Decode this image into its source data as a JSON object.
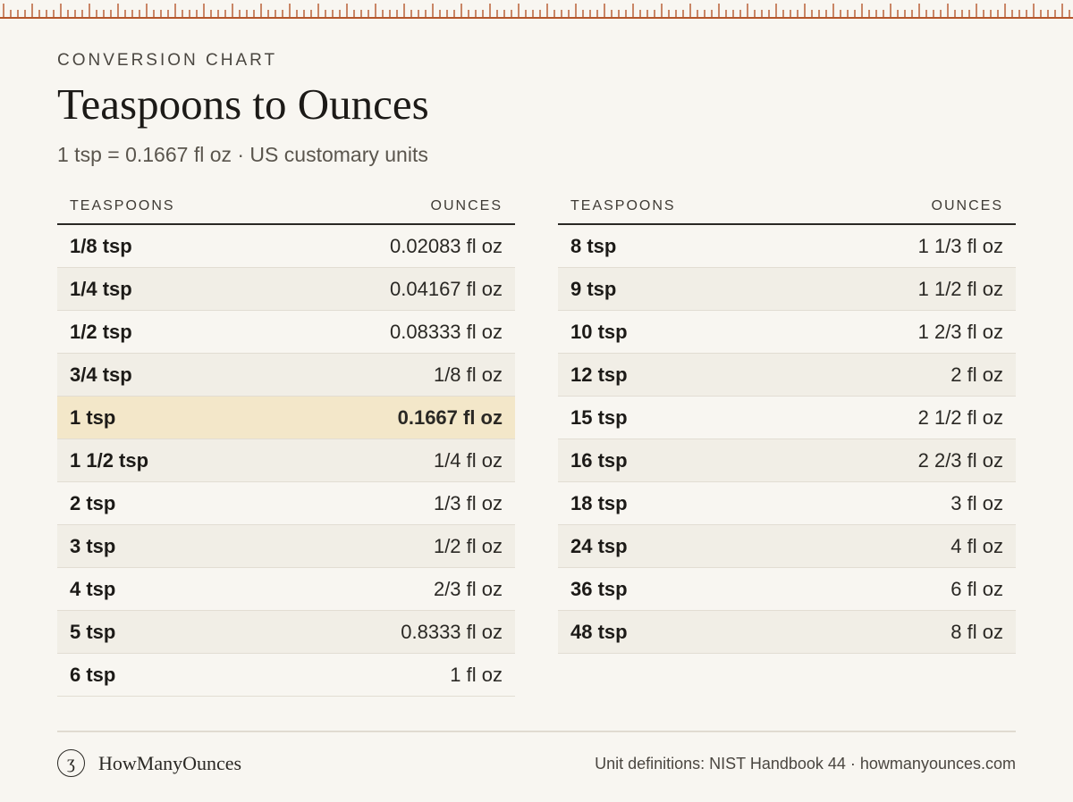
{
  "header": {
    "eyebrow": "CONVERSION CHART",
    "title": "Teaspoons to Ounces",
    "subtitle": "1 tsp = 0.1667 fl oz · US customary units"
  },
  "colors": {
    "ruler": "#b5572c",
    "background": "#f8f6f1",
    "highlight_row": "#f3e7c9",
    "alt_row": "#f1eee6"
  },
  "table_left": {
    "col_tsp": "TEASPOONS",
    "col_oz": "OUNCES",
    "rows": [
      {
        "tsp": "1/8 tsp",
        "oz": "0.02083 fl oz"
      },
      {
        "tsp": "1/4 tsp",
        "oz": "0.04167 fl oz"
      },
      {
        "tsp": "1/2 tsp",
        "oz": "0.08333 fl oz"
      },
      {
        "tsp": "3/4 tsp",
        "oz": "1/8 fl oz"
      },
      {
        "tsp": "1 tsp",
        "oz": "0.1667 fl oz",
        "highlight": true
      },
      {
        "tsp": "1 1/2 tsp",
        "oz": "1/4 fl oz"
      },
      {
        "tsp": "2 tsp",
        "oz": "1/3 fl oz"
      },
      {
        "tsp": "3 tsp",
        "oz": "1/2 fl oz"
      },
      {
        "tsp": "4 tsp",
        "oz": "2/3 fl oz"
      },
      {
        "tsp": "5 tsp",
        "oz": "0.8333 fl oz"
      },
      {
        "tsp": "6 tsp",
        "oz": "1 fl oz"
      }
    ]
  },
  "table_right": {
    "col_tsp": "TEASPOONS",
    "col_oz": "OUNCES",
    "rows": [
      {
        "tsp": "8 tsp",
        "oz": "1 1/3 fl oz"
      },
      {
        "tsp": "9 tsp",
        "oz": "1 1/2 fl oz"
      },
      {
        "tsp": "10 tsp",
        "oz": "1 2/3 fl oz"
      },
      {
        "tsp": "12 tsp",
        "oz": "2 fl oz"
      },
      {
        "tsp": "15 tsp",
        "oz": "2 1/2 fl oz"
      },
      {
        "tsp": "16 tsp",
        "oz": "2 2/3 fl oz"
      },
      {
        "tsp": "18 tsp",
        "oz": "3 fl oz"
      },
      {
        "tsp": "24 tsp",
        "oz": "4 fl oz"
      },
      {
        "tsp": "36 tsp",
        "oz": "6 fl oz"
      },
      {
        "tsp": "48 tsp",
        "oz": "8 fl oz"
      }
    ]
  },
  "footer": {
    "logo_glyph": "ʒ",
    "brand": "HowManyOunces",
    "credits": "Unit definitions: NIST Handbook 44 · howmanyounces.com"
  }
}
